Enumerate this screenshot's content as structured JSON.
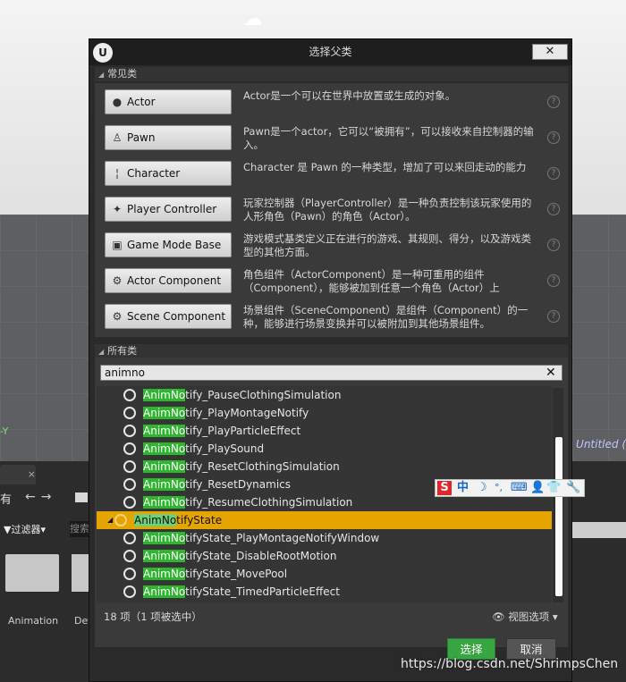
{
  "background": {
    "axis_label": "-Y",
    "viewport_label": "Untitled (",
    "content_browser": {
      "tab_close": "×",
      "tab_label": "有",
      "nav_arrows": "←→",
      "filter_label": "▼过滤器▾",
      "search_stub": "搜索",
      "folders": [
        "Animation",
        "Dev"
      ]
    }
  },
  "dialog": {
    "title": "选择父类",
    "logo": "U",
    "close_label": "✕",
    "common_header": "常见类",
    "all_header": "所有类",
    "help_glyph": "?",
    "common_classes": [
      {
        "name": "Actor",
        "icon": "sphere-icon",
        "glyph": "●",
        "desc": "Actor是一个可以在世界中放置或生成的对象。"
      },
      {
        "name": "Pawn",
        "icon": "pawn-icon",
        "glyph": "♙",
        "desc": "Pawn是一个actor，它可以“被拥有”，可以接收来自控制器的输入。"
      },
      {
        "name": "Character",
        "icon": "character-icon",
        "glyph": "¦",
        "desc": "Character 是 Pawn 的一种类型，增加了可以来回走动的能力"
      },
      {
        "name": "Player Controller",
        "icon": "controller-icon",
        "glyph": "✦",
        "desc": "玩家控制器（PlayerController）是一种负责控制该玩家使用的人形角色（Pawn）的角色（Actor）。"
      },
      {
        "name": "Game Mode Base",
        "icon": "game-mode-icon",
        "glyph": "▣",
        "desc": "游戏模式基类定义正在进行的游戏、其规则、得分，以及游戏类型的其他方面。"
      },
      {
        "name": "Actor Component",
        "icon": "component-icon",
        "glyph": "⚙",
        "desc": "角色组件（ActorComponent）是一种可重用的组件（Component），能够被加到任意一个角色（Actor）上"
      },
      {
        "name": "Scene Component",
        "icon": "scene-component-icon",
        "glyph": "⚙",
        "desc": "场景组件（SceneComponent）是组件（Component）的一种，能够进行场景变换并可以被附加到其他场景组件。"
      }
    ],
    "search": {
      "value": "animno",
      "clear": "✕"
    },
    "tree": [
      {
        "hl": "AnimNo",
        "rest": "tify_PauseClothingSimulation",
        "selected": false
      },
      {
        "hl": "AnimNo",
        "rest": "tify_PlayMontageNotify",
        "selected": false
      },
      {
        "hl": "AnimNo",
        "rest": "tify_PlayParticleEffect",
        "selected": false
      },
      {
        "hl": "AnimNo",
        "rest": "tify_PlaySound",
        "selected": false
      },
      {
        "hl": "AnimNo",
        "rest": "tify_ResetClothingSimulation",
        "selected": false
      },
      {
        "hl": "AnimNo",
        "rest": "tify_ResetDynamics",
        "selected": false
      },
      {
        "hl": "AnimNo",
        "rest": "tify_ResumeClothingSimulation",
        "selected": false
      },
      {
        "hl": "AnimNo",
        "rest": "tifyState",
        "selected": true
      },
      {
        "hl": "AnimNo",
        "rest": "tifyState_PlayMontageNotifyWindow",
        "selected": false
      },
      {
        "hl": "AnimNo",
        "rest": "tifyState_DisableRootMotion",
        "selected": false
      },
      {
        "hl": "AnimNo",
        "rest": "tifyState_MovePool",
        "selected": false
      },
      {
        "hl": "AnimNo",
        "rest": "tifyState_TimedParticleEffect",
        "selected": false
      }
    ],
    "status": "18 项（1 项被选中）",
    "view_options": "视图选项",
    "select_label": "选择",
    "cancel_label": "取消"
  },
  "ime": {
    "logo": "S",
    "mode": "中",
    "items": [
      "☽",
      "°,",
      "⌨",
      "👤",
      "👕",
      "🔧"
    ]
  },
  "watermark": "https://blog.csdn.net/ShrimpsChen",
  "colors": {
    "highlight": "#2fb52f",
    "selected_row": "#e5a400",
    "select_button": "#37a642"
  }
}
